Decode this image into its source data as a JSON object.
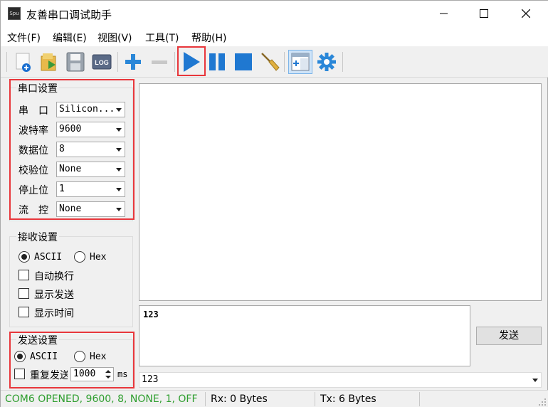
{
  "window": {
    "title": "友善串口调试助手",
    "icon_text": "Spu"
  },
  "menu": {
    "items": [
      "文件(F)",
      "编辑(E)",
      "视图(V)",
      "工具(T)",
      "帮助(H)"
    ]
  },
  "toolbar": {
    "icons": [
      "new-icon",
      "open-icon",
      "save-icon",
      "log-icon",
      "add-icon",
      "remove-icon",
      "play-icon",
      "pause-icon",
      "stop-icon",
      "clear-broom-icon",
      "panel-icon",
      "settings-gear-icon"
    ],
    "log_label": "LOG"
  },
  "serial_settings": {
    "title": "串口设置",
    "port_label": "串　口",
    "port_value": "Silicon...",
    "baud_label": "波特率",
    "baud_value": "9600",
    "databits_label": "数据位",
    "databits_value": "8",
    "parity_label": "校验位",
    "parity_value": "None",
    "stopbits_label": "停止位",
    "stopbits_value": "1",
    "flow_label": "流　控",
    "flow_value": "None"
  },
  "receive_settings": {
    "title": "接收设置",
    "ascii_label": "ASCII",
    "hex_label": "Hex",
    "selected": "ASCII",
    "auto_newline_label": "自动换行",
    "show_send_label": "显示发送",
    "show_time_label": "显示时间"
  },
  "send_settings": {
    "title": "发送设置",
    "ascii_label": "ASCII",
    "hex_label": "Hex",
    "selected": "ASCII",
    "repeat_label": "重复发送",
    "interval_value": "1000",
    "interval_unit": "ms"
  },
  "send_area": {
    "text": "123",
    "send_button": "发送",
    "history_value": "123"
  },
  "status": {
    "connection": "COM6 OPENED, 9600, 8, NONE, 1, OFF",
    "rx": "Rx: 0 Bytes",
    "tx": "Tx: 6 Bytes"
  },
  "colors": {
    "status_green": "#2e9e2e",
    "highlight_red": "#e8363b",
    "play_blue": "#1f78d1"
  }
}
